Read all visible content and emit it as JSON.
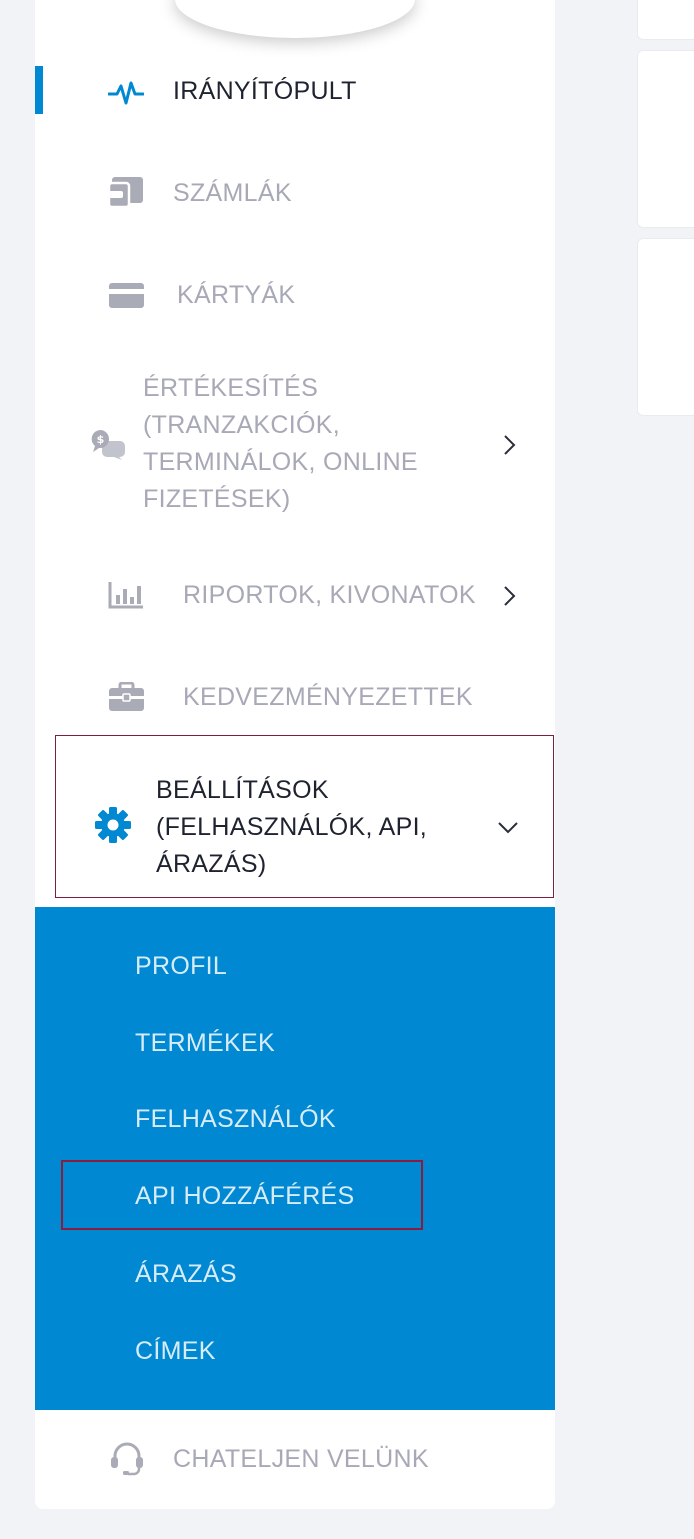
{
  "sidebar": {
    "items": [
      {
        "label": "IRÁNYÍTÓPULT",
        "icon": "pulse-icon",
        "active": true
      },
      {
        "label": "SZÁMLÁK",
        "icon": "wallet-icon"
      },
      {
        "label": "KÁRTYÁK",
        "icon": "card-icon"
      },
      {
        "label": "ÉRTÉKESÍTÉS (TRANZAKCIÓK, TERMINÁLOK, ONLINE FIZETÉSEK)",
        "icon": "chat-dollar-icon",
        "has_children": true
      },
      {
        "label": "RIPORTOK, KIVONATOK",
        "icon": "bar-chart-icon",
        "has_children": true
      },
      {
        "label": "KEDVEZMÉNYEZETTEK",
        "icon": "briefcase-icon"
      },
      {
        "label": "BEÁLLÍTÁSOK (FELHASZNÁLÓK, API, ÁRAZÁS)",
        "icon": "gear-icon",
        "expanded": true
      }
    ],
    "settings_submenu": [
      {
        "label": "PROFIL"
      },
      {
        "label": "TERMÉKEK"
      },
      {
        "label": "FELHASZNÁLÓK"
      },
      {
        "label": "API HOZZÁFÉRÉS",
        "highlighted": true
      },
      {
        "label": "ÁRAZÁS"
      },
      {
        "label": "CÍMEK"
      }
    ],
    "footer": {
      "label": "CHATELJEN VELÜNK",
      "icon": "headset-icon"
    }
  },
  "colors": {
    "accent": "#0089d2",
    "active_text": "#1f2330",
    "inactive_text": "#a7a9b6",
    "icon_gray": "#a9abb6",
    "submenu_text": "#d8ecf8",
    "highlight_border": "#8a1d3a"
  }
}
